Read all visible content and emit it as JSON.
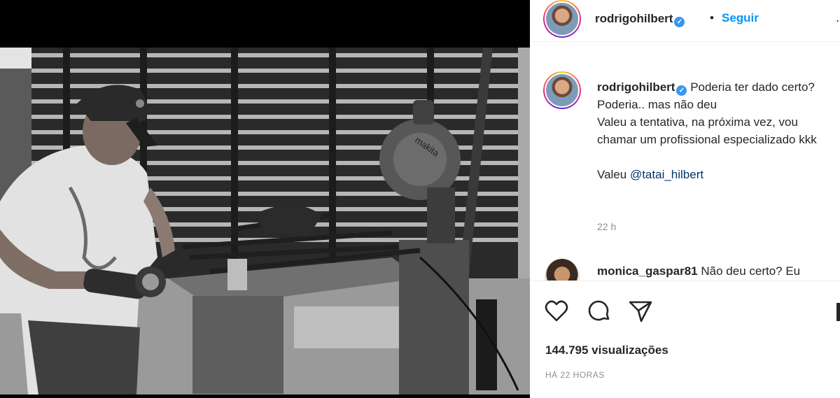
{
  "post": {
    "username": "rodrigohilbert",
    "dot": "•",
    "follow_label": "Seguir",
    "more_icon": "more-options-icon",
    "caption": {
      "username": "rodrigohilbert",
      "line1": "Poderia ter dado certo? Poderia.. mas não deu",
      "line2": "Valeu a tentativa, na próxima vez, vou chamar um profissional especializado kkk",
      "line3_prefix": "Valeu ",
      "mention": "@tatai_hilbert",
      "time": "22 h"
    },
    "comments": [
      {
        "username": "monica_gaspar81",
        "text": "Não deu certo? Eu"
      }
    ],
    "actions": {
      "like_icon": "heart-icon",
      "comment_icon": "comment-bubble-icon",
      "share_icon": "paper-plane-icon",
      "save_icon": "bookmark-icon"
    },
    "views": "144.795 visualizações",
    "timestamp": "HÁ 22 HORAS"
  },
  "media": {
    "saw_brand_text": "makita"
  },
  "colors": {
    "accent": "#0095f6",
    "text": "#262626",
    "muted": "#8e8e8e",
    "mention": "#00376b"
  }
}
